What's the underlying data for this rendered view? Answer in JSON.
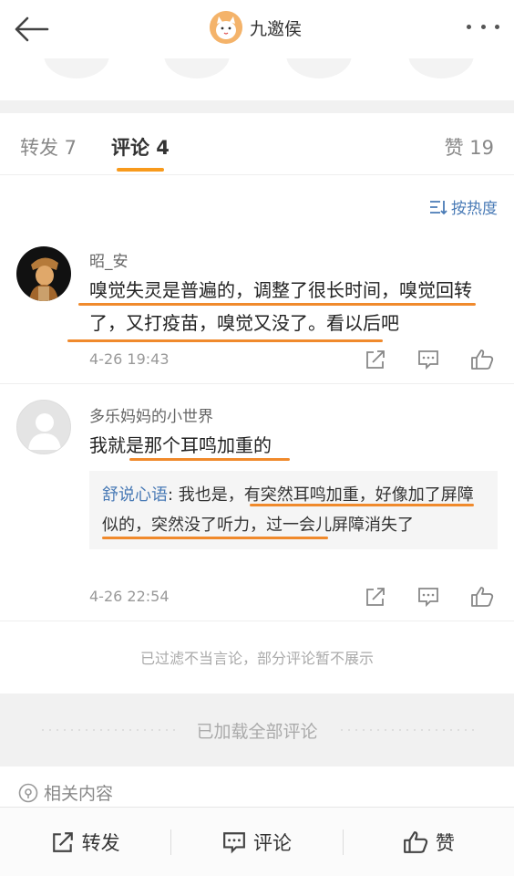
{
  "header": {
    "author_name": "九邀侯"
  },
  "tabs": {
    "repost": "转发 7",
    "comments": "评论 4",
    "likes": "赞 19"
  },
  "sort": {
    "label": "按热度"
  },
  "comments": [
    {
      "author": "昭_安",
      "text": "嗅觉失灵是普遍的，调整了很长时间，嗅觉回转了，又打疫苗，嗅觉又没了。看以后吧",
      "time": "4-26 19:43"
    },
    {
      "author": "多乐妈妈的小世界",
      "text": "我就是那个耳鸣加重的",
      "time": "4-26 22:54",
      "reply": {
        "author": "舒说心语",
        "text": ": 我也是，有突然耳鸣加重，好像加了屏障似的，突然没了听力，过一会儿屏障消失了"
      }
    }
  ],
  "filter_note": "已过滤不当言论，部分评论暂不展示",
  "loaded_text": "已加载全部评论",
  "related_label": "相关内容",
  "bottom_bar": {
    "repost": "转发",
    "comment": "评论",
    "like": "赞"
  },
  "colors": {
    "accent": "#f89a1c",
    "link": "#4a7bb6",
    "highlight": "#f08a2c"
  }
}
